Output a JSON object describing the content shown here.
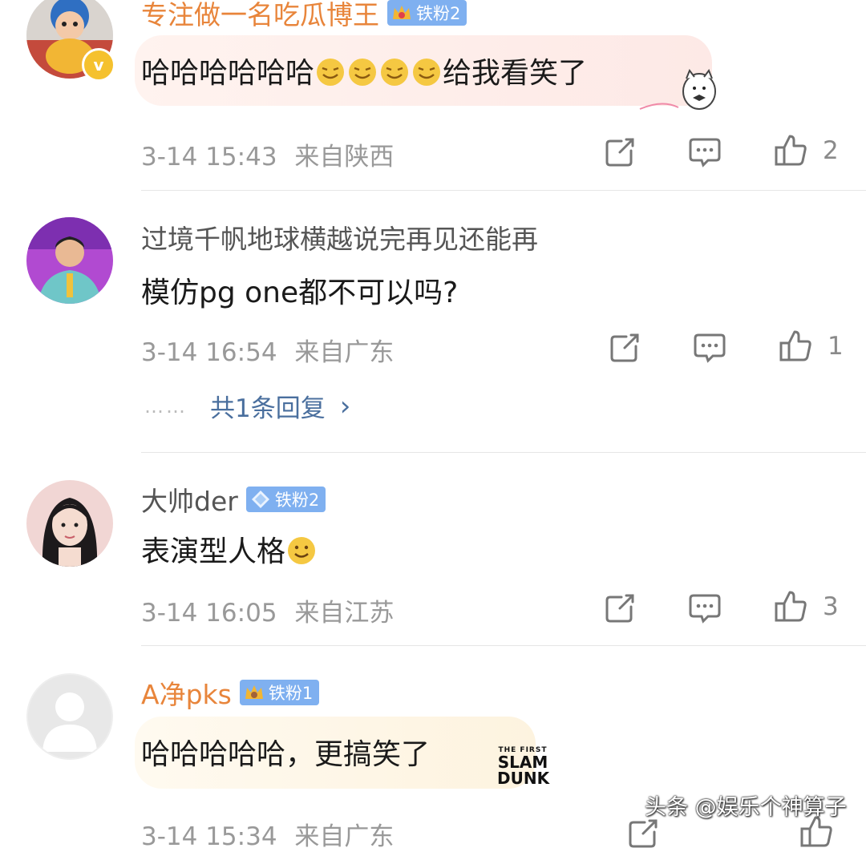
{
  "comments": [
    {
      "username": "专注做一名吃瓜博王",
      "badge": "铁粉2",
      "text_before": "哈哈哈哈哈哈",
      "text_after": "给我看笑了",
      "time": "3-14 15:43",
      "location": "来自陕西",
      "likes": "2",
      "avatar_icon": "cartoon-avatar-icon",
      "verified": true
    },
    {
      "username": "过境千帆地球横越说完再见还能再",
      "text": "模仿pg one都不可以吗?",
      "time": "3-14 16:54",
      "location": "来自广东",
      "likes": "1",
      "reply_link": "共1条回复",
      "reply_dots": "……",
      "reply_arrow": "›",
      "avatar_icon": "host-avatar-icon"
    },
    {
      "username": "大帅der",
      "badge": "铁粉2",
      "text": "表演型人格",
      "time": "3-14 16:05",
      "location": "来自江苏",
      "likes": "3",
      "avatar_icon": "girl-avatar-icon"
    },
    {
      "username": "A净pks",
      "badge": "铁粉1",
      "text": "哈哈哈哈哈，更搞笑了",
      "time": "3-14 15:34",
      "location": "来自广东",
      "avatar_icon": "default-avatar-icon",
      "sticker_text": [
        "THE FIRST",
        "SLAM",
        "DUNK"
      ]
    }
  ],
  "watermark": "头条 @娱乐个神算子",
  "colors": {
    "username_orange": "#e8853b",
    "badge_blue": "#7fb0f0",
    "meta_gray": "#999999",
    "reply_link": "#4a6f9e"
  }
}
